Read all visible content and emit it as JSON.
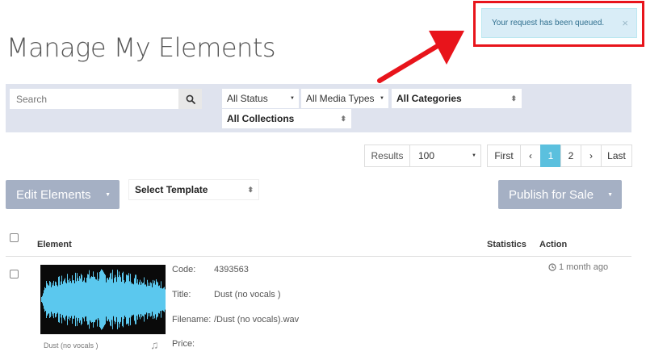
{
  "page_title": "Manage My Elements",
  "toast": {
    "message": "Your request has been queued.",
    "close": "×"
  },
  "filters": {
    "search_placeholder": "Search",
    "status": "All Status",
    "media_types": "All Media Types",
    "categories": "All Categories",
    "collections": "All Collections"
  },
  "results": {
    "label": "Results",
    "value": "100"
  },
  "pagination": {
    "first": "First",
    "prev": "‹",
    "pages": [
      "1",
      "2"
    ],
    "next": "›",
    "last": "Last",
    "current": "1"
  },
  "actions": {
    "edit_label": "Edit Elements",
    "template_label": "Select Template",
    "publish_label": "Publish for Sale"
  },
  "table": {
    "headers": {
      "element": "Element",
      "statistics": "Statistics",
      "action": "Action"
    },
    "rows": [
      {
        "caption": "Dust (no vocals )",
        "code_label": "Code:",
        "code": "4393563",
        "title_label": "Title:",
        "title": "Dust (no vocals )",
        "filename_label": "Filename:",
        "filename": "/Dust (no vocals).wav",
        "price_label": "Price:",
        "price": "",
        "time": "1 month ago"
      }
    ]
  },
  "colors": {
    "waveform": "#5bc8ee",
    "accent": "#5bc0de",
    "arrow": "#e8141b"
  }
}
